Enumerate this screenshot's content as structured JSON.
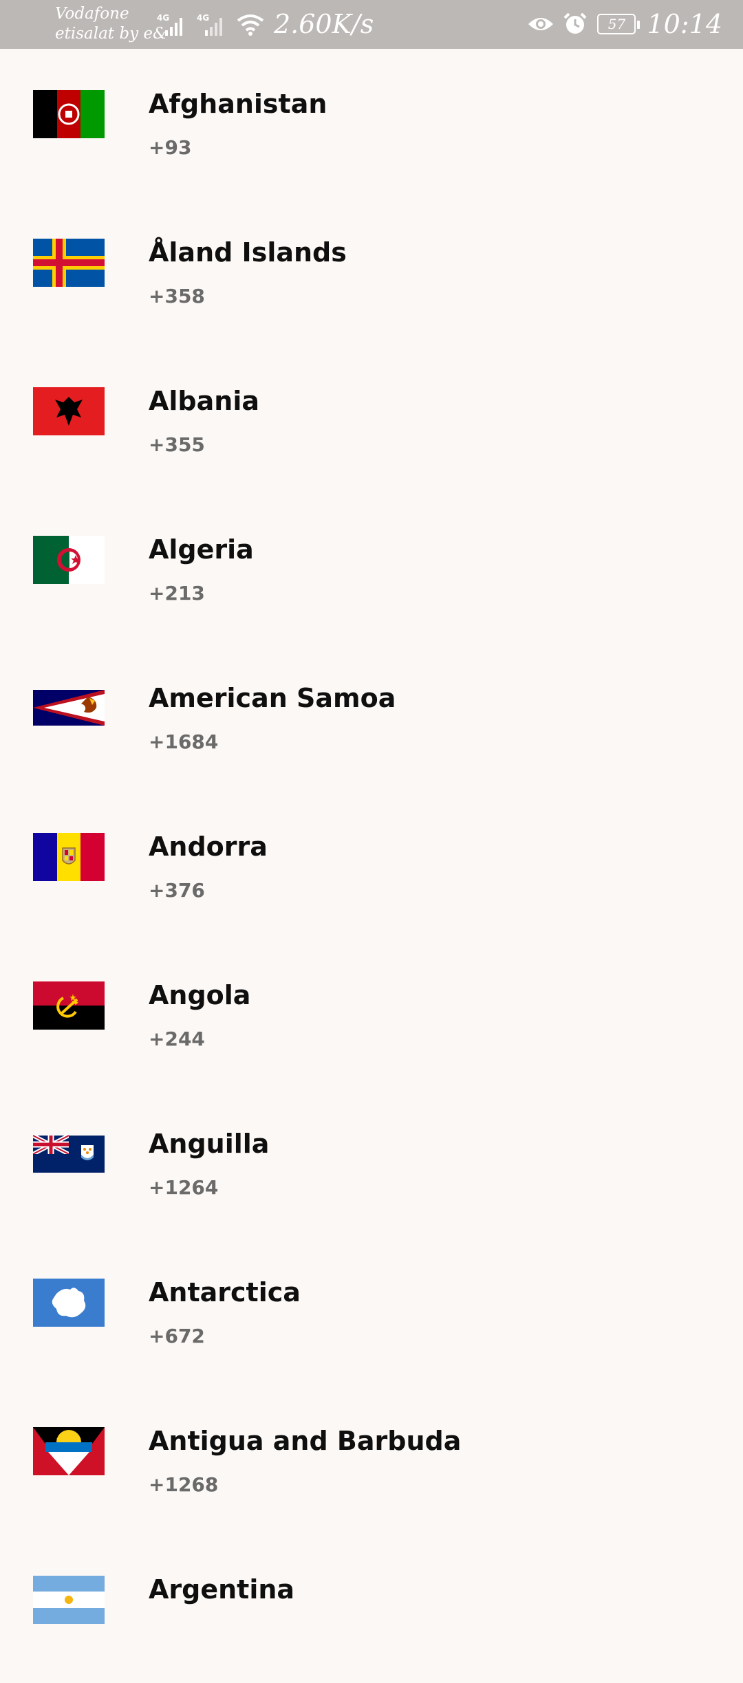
{
  "status_bar": {
    "carrier_line1": "Vodafone",
    "carrier_line2": "etisalat by e&",
    "network1": "4G",
    "network2": "4G",
    "speed": "2.60K/s",
    "battery": "57",
    "time": "10:14",
    "icons": [
      "signal-icon",
      "signal-icon",
      "wifi-icon",
      "eye-icon",
      "alarm-icon",
      "battery-icon"
    ]
  },
  "countries": [
    {
      "name": "Afghanistan",
      "code": "+93",
      "flag": "afghanistan-flag"
    },
    {
      "name": "Åland Islands",
      "code": "+358",
      "flag": "aland-islands-flag"
    },
    {
      "name": "Albania",
      "code": "+355",
      "flag": "albania-flag"
    },
    {
      "name": "Algeria",
      "code": "+213",
      "flag": "algeria-flag"
    },
    {
      "name": "American Samoa",
      "code": "+1684",
      "flag": "american-samoa-flag"
    },
    {
      "name": "Andorra",
      "code": "+376",
      "flag": "andorra-flag"
    },
    {
      "name": "Angola",
      "code": "+244",
      "flag": "angola-flag"
    },
    {
      "name": "Anguilla",
      "code": "+1264",
      "flag": "anguilla-flag"
    },
    {
      "name": "Antarctica",
      "code": "+672",
      "flag": "antarctica-flag"
    },
    {
      "name": "Antigua and Barbuda",
      "code": "+1268",
      "flag": "antigua-and-barbuda-flag"
    },
    {
      "name": "Argentina",
      "code": "",
      "flag": "argentina-flag"
    }
  ],
  "colors": {
    "background": "#fcf8f5",
    "status_bar": "#bcb8b5",
    "name_text": "#0f0f0f",
    "code_text": "#6a6a6a"
  }
}
